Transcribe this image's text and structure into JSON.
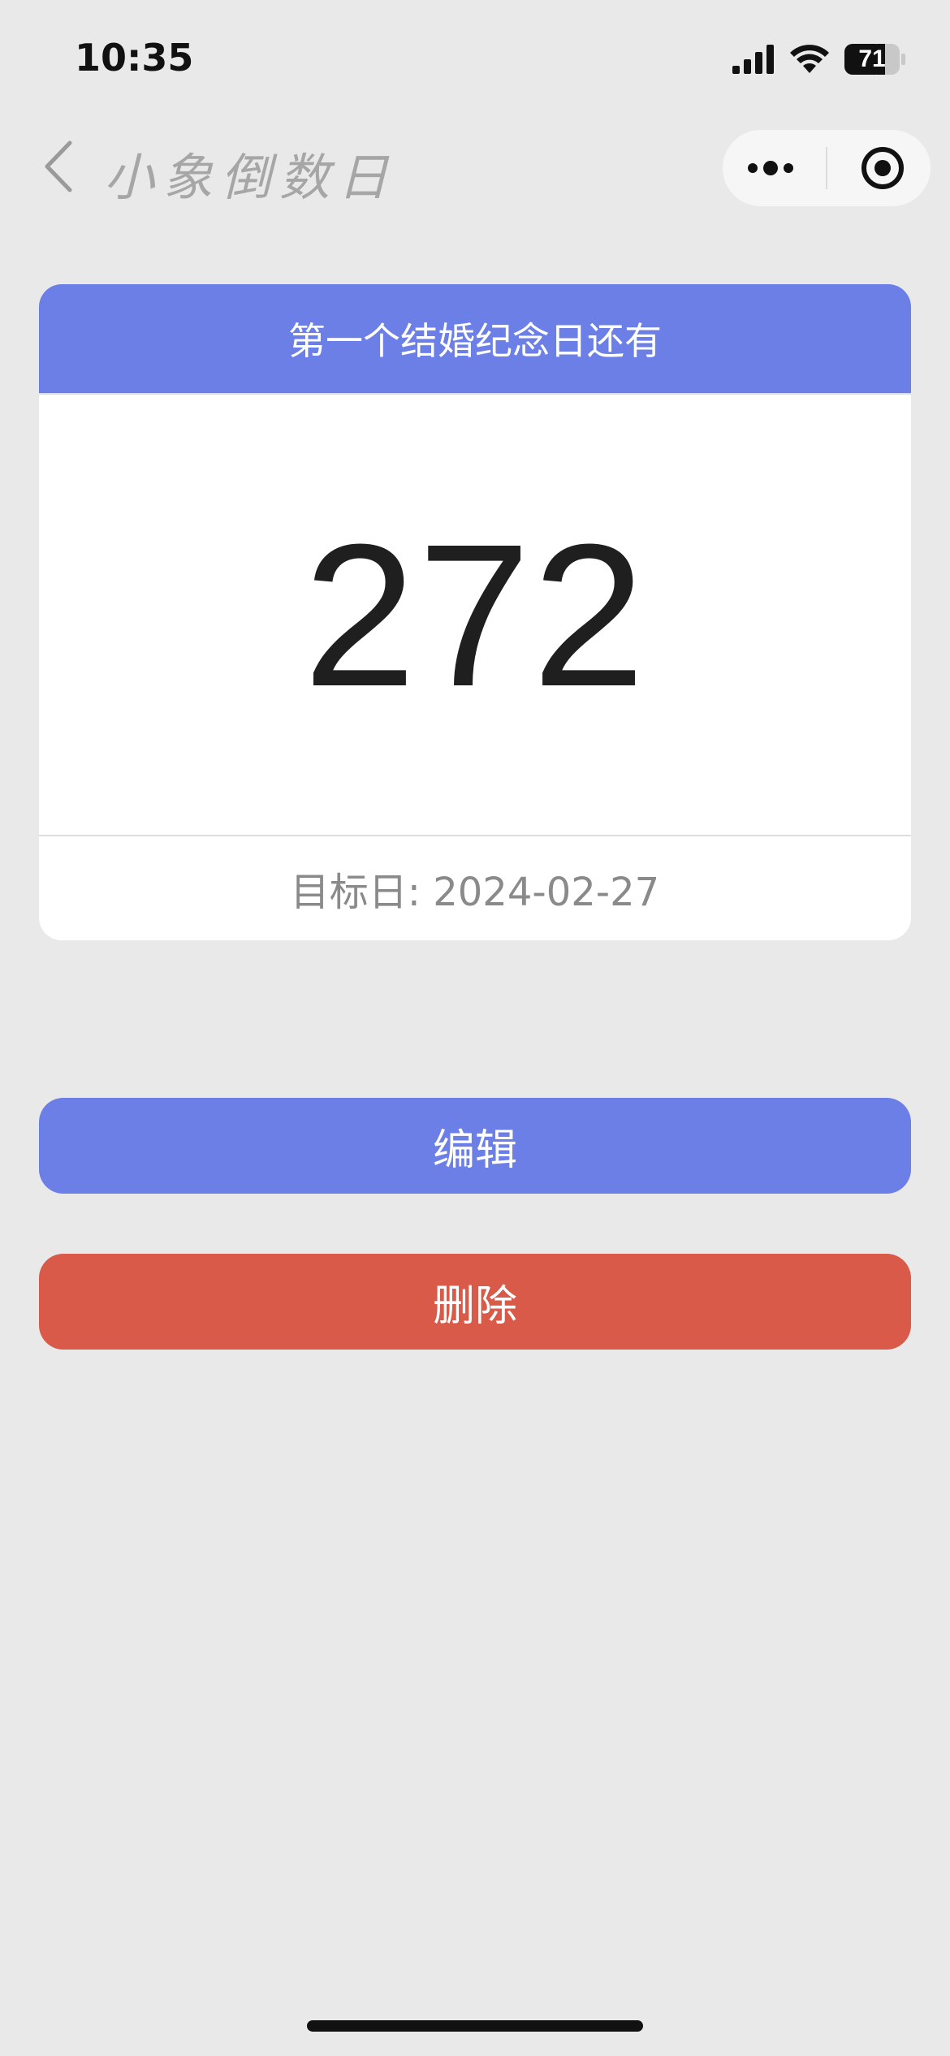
{
  "status_bar": {
    "time": "10:35",
    "battery": "71"
  },
  "nav": {
    "title": "小象倒数日"
  },
  "card": {
    "header": "第一个结婚纪念日还有",
    "days": "272",
    "target_label": "目标日: 2024-02-27"
  },
  "actions": {
    "edit_label": "编辑",
    "delete_label": "删除"
  },
  "colors": {
    "accent": "#6b7fe6",
    "danger": "#d95a48",
    "background": "#e9e9ea"
  }
}
